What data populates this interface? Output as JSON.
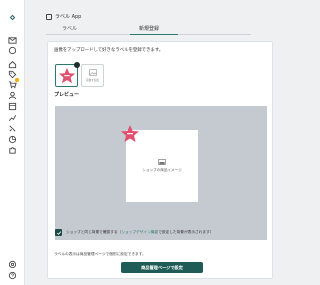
{
  "header": {
    "title": "ラベル App"
  },
  "tabs": [
    {
      "label": "ラベル"
    },
    {
      "label": "新規登録"
    }
  ],
  "main": {
    "instruction": "画像をアップロードして好きなラベルを登録できます。",
    "upload_label": "画像を追加",
    "preview_title": "プレビュー",
    "product_image_label": "ショップの商品イメージ",
    "option": {
      "prefix": "ショップと同じ背景で確認する（",
      "link": "ショップデザイン機能",
      "suffix": "で設定した背景が表示されます）"
    },
    "footer_note": "ラベルの表示は商品管理ページで個別に設定できます。",
    "primary_button": "商品管理ページで設定"
  },
  "colors": {
    "accent": "#2a7a6e",
    "button": "#1f5c57",
    "star": "#e0516f",
    "preview_bg": "#c5c9d0",
    "badge": "#f0b000"
  },
  "sidebar_icons": [
    "logo-icon",
    "mail-icon",
    "chat-icon",
    "home-icon",
    "tag-icon",
    "cart-icon",
    "user-icon",
    "pages-icon",
    "chart-icon",
    "megaphone-icon",
    "pie-chart-icon",
    "puzzle-icon",
    "settings-icon",
    "help-icon"
  ]
}
